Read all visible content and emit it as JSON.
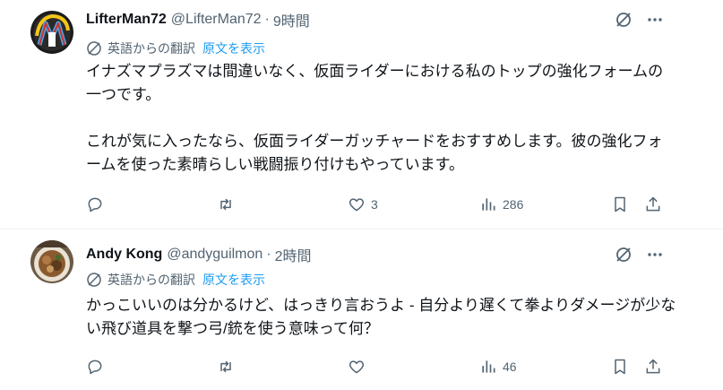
{
  "posts": [
    {
      "display_name": "LifterMan72",
      "handle": "@LifterMan72",
      "separator": "·",
      "time": "9時間",
      "translation_label": "英語からの翻訳",
      "show_original": "原文を表示",
      "paragraphs": [
        "イナズマプラズマは間違いなく、仮面ライダーにおける私のトップの強化フォームの一つです。",
        "これが気に入ったなら、仮面ライダーガッチャードをおすすめします。彼の強化フォームを使った素晴らしい戦闘振り付けもやっています。"
      ],
      "likes": "3",
      "views": "286",
      "icons": [
        "grok-icon",
        "more-icon",
        "reply-icon",
        "repost-icon",
        "like-icon",
        "views-icon",
        "bookmark-icon",
        "share-icon"
      ]
    },
    {
      "display_name": "Andy Kong",
      "handle": "@andyguilmon",
      "separator": "·",
      "time": "2時間",
      "translation_label": "英語からの翻訳",
      "show_original": "原文を表示",
      "paragraphs": [
        "かっこいいのは分かるけど、はっきり言おうよ - 自分より遅くて拳よりダメージが少ない飛び道具を撃つ弓/銃を使う意味って何？"
      ],
      "views": "46",
      "icons": [
        "grok-icon",
        "more-icon",
        "reply-icon",
        "repost-icon",
        "like-icon",
        "views-icon",
        "bookmark-icon",
        "share-icon"
      ]
    }
  ],
  "colors": {
    "text": "#0f1419",
    "secondary": "#536471",
    "link": "#1d9bf0",
    "divider": "#eff3f4"
  }
}
